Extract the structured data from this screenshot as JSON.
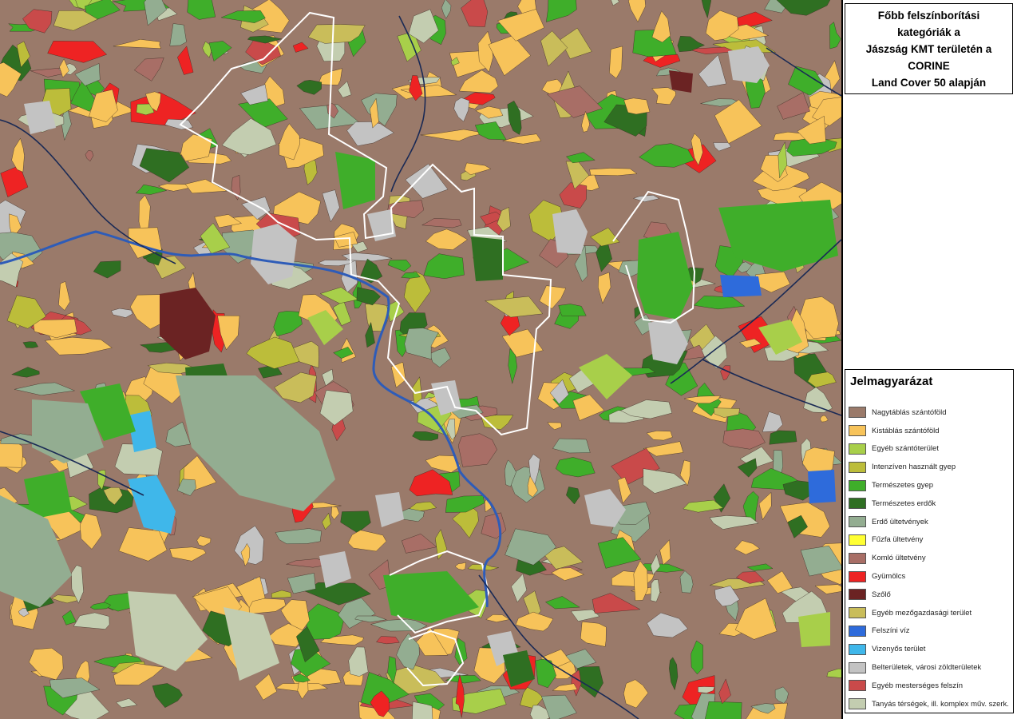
{
  "title": {
    "lines": [
      "Főbb felszínborítási kategóriák a",
      "Jászság KMT területén a CORINE",
      "Land Cover 50 alapján"
    ]
  },
  "legend": {
    "title": "Jelmagyarázat",
    "items": [
      {
        "label": "Nagytáblás szántóföld",
        "color": "#9a7a6a"
      },
      {
        "label": "Kistáblás szántóföld",
        "color": "#f7c35a"
      },
      {
        "label": "Egyéb szántóterület",
        "color": "#a8cf4a"
      },
      {
        "label": "Intenzíven használt gyep",
        "color": "#bcbd3a"
      },
      {
        "label": "Természetes gyep",
        "color": "#3fae2a"
      },
      {
        "label": "Természetes erdők",
        "color": "#2f6f22"
      },
      {
        "label": "Erdő ültetvények",
        "color": "#93ad91"
      },
      {
        "label": "Fűzfa ültetvény",
        "color": "#ffff33"
      },
      {
        "label": "Komló ültetvény",
        "color": "#a86e66"
      },
      {
        "label": "Gyümölcs",
        "color": "#ee2323"
      },
      {
        "label": "Szőlő",
        "color": "#6b2323"
      },
      {
        "label": "Egyéb mezőgazdasági terület",
        "color": "#c9bd5a"
      },
      {
        "label": "Felszíni víz",
        "color": "#2e6bdb"
      },
      {
        "label": "Vizenyős terület",
        "color": "#3fb7ea"
      },
      {
        "label": "Belterületek, városi zöldterületek",
        "color": "#c3c3c3"
      },
      {
        "label": "Egyéb mesterséges felszín",
        "color": "#c94a4a"
      },
      {
        "label": "Tanyás térségek, ill. komplex műv. szerk.",
        "color": "#c3cdb0"
      }
    ]
  },
  "map": {
    "background_color": "#9a7a6a",
    "boundary_color": "#ffffff",
    "river_color": "#2e5cb8",
    "road_color": "#1a2a55"
  }
}
